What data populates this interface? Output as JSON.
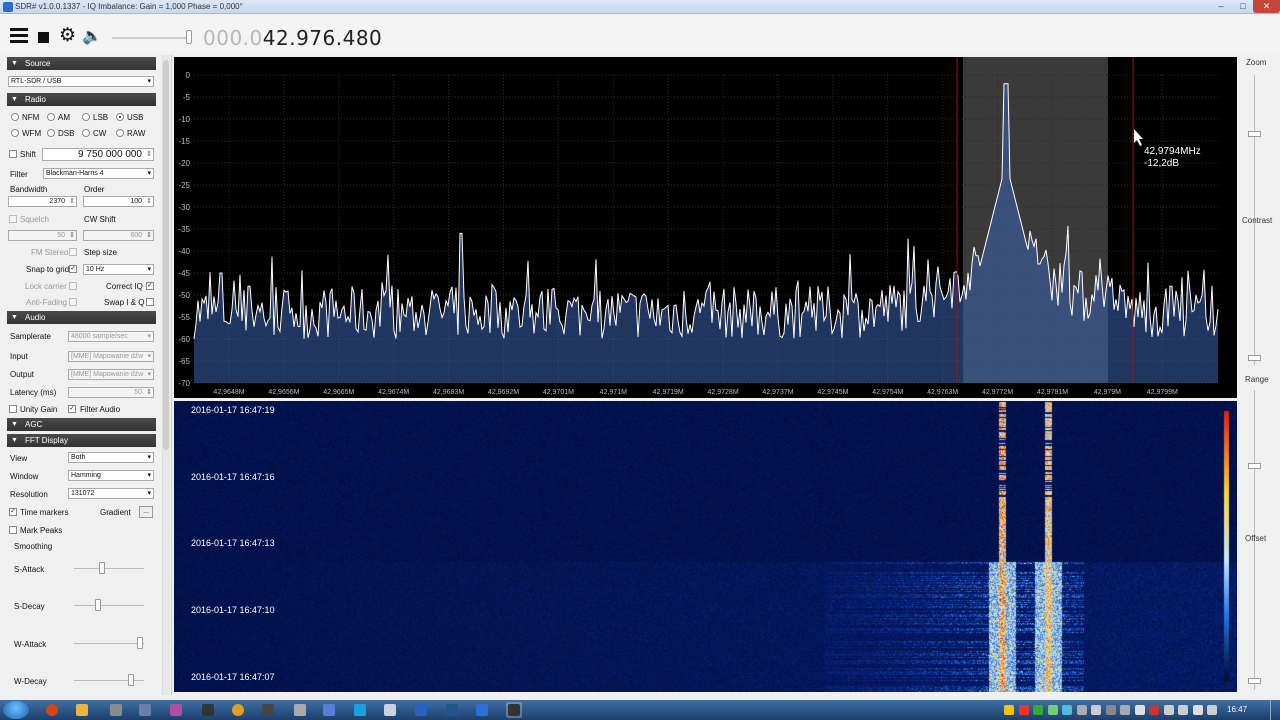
{
  "window": {
    "title": "SDR# v1.0.0.1337 - IQ Imbalance: Gain = 1,000 Phase = 0,000°",
    "controls": [
      "–",
      "□",
      "✕"
    ]
  },
  "toolbar": {
    "freq_dim": "000.0",
    "freq_bright": "42.976.480",
    "volume_level": 0.97
  },
  "sections": {
    "source": "Source",
    "radio": "Radio",
    "audio": "Audio",
    "agc": "AGC",
    "fft": "FFT Display"
  },
  "source": {
    "device": "RTL-SDR / USB"
  },
  "radio": {
    "modes": [
      {
        "label": "NFM",
        "selected": false
      },
      {
        "label": "AM",
        "selected": false
      },
      {
        "label": "LSB",
        "selected": false
      },
      {
        "label": "USB",
        "selected": true
      },
      {
        "label": "WFM",
        "selected": false
      },
      {
        "label": "DSB",
        "selected": false
      },
      {
        "label": "CW",
        "selected": false
      },
      {
        "label": "RAW",
        "selected": false
      }
    ],
    "shift_label": "Shift",
    "shift_value": "9 750 000 000",
    "filter_label": "Filter",
    "filter_value": "Blackman-Harris 4",
    "bandwidth_label": "Bandwidth",
    "bandwidth_value": "2370",
    "order_label": "Order",
    "order_value": "100",
    "squelch_label": "Squelch",
    "squelch_value": "50",
    "cwshift_label": "CW Shift",
    "cwshift_value": "600",
    "fmstereo_label": "FM Stereo",
    "stepsize_label": "Step size",
    "snap_label": "Snap to grid",
    "snap_value": "10 Hz",
    "lockcarrier_label": "Lock carrier",
    "correctiq_label": "Correct IQ",
    "antifading_label": "Anti-Fading",
    "swapiq_label": "Swap I & Q"
  },
  "audio": {
    "samplerate_label": "Samplerate",
    "samplerate_value": "48000 sample/sec",
    "input_label": "Input",
    "input_value": "[MME] Mapowanie dźw",
    "output_label": "Output",
    "output_value": "[MME] Mapowanie dźw",
    "latency_label": "Latency (ms)",
    "latency_value": "50",
    "unity_label": "Unity Gain",
    "filteraudio_label": "Filter Audio"
  },
  "fft": {
    "view_label": "View",
    "view_value": "Both",
    "window_label": "Window",
    "window_value": "Hamming",
    "resolution_label": "Resolution",
    "resolution_value": "131072",
    "timemarkers_label": "Time markers",
    "gradient_label": "Gradient",
    "gradient_button": "...",
    "markpeaks_label": "Mark Peaks",
    "smoothing_label": "Smoothing",
    "sattack_label": "S-Attack",
    "sdecay_label": "S-Decay",
    "wattack_label": "W-Attack",
    "wdecay_label": "W-Decay"
  },
  "spectrum": {
    "y_ticks": [
      "0",
      "-5",
      "-10",
      "-15",
      "-20",
      "-25",
      "-30",
      "-35",
      "-40",
      "-45",
      "-50",
      "-55",
      "-60",
      "-65",
      "-70"
    ],
    "x_ticks": [
      "42,9648M",
      "42,9656M",
      "42,9665M",
      "42,9674M",
      "42,9683M",
      "42,9692M",
      "42,9701M",
      "42,971M",
      "42,9719M",
      "42,9728M",
      "42,9737M",
      "42,9745M",
      "42,9754M",
      "42,9763M",
      "42,9772M",
      "42,9781M",
      "42,979M",
      "42,9799M"
    ],
    "cursor_freq": "42,9794MHz",
    "cursor_level": "-12,2dB",
    "passband_color": "#3a3a3a",
    "trace_color": "#ffffff",
    "fill_color": "#3a63b0"
  },
  "waterfall": {
    "timestamps": [
      "2016-01-17 16:47:19",
      "2016-01-17 16:47:16",
      "2016-01-17 16:47:13",
      "2016-01-17 16:47:10",
      "2016-01-17 16:47:07"
    ]
  },
  "right_panel": {
    "zoom_label": "Zoom",
    "contrast_label": "Contrast",
    "range_label": "Range",
    "offset_label": "Offset"
  },
  "taskbar": {
    "clock": "16:47",
    "apps": [
      "firefox",
      "folder",
      "usb",
      "computer",
      "media",
      "terminal",
      "chrome",
      "pin",
      "dash",
      "monitor",
      "skype",
      "tools",
      "word",
      "powershell",
      "rdp",
      "sdr"
    ]
  }
}
